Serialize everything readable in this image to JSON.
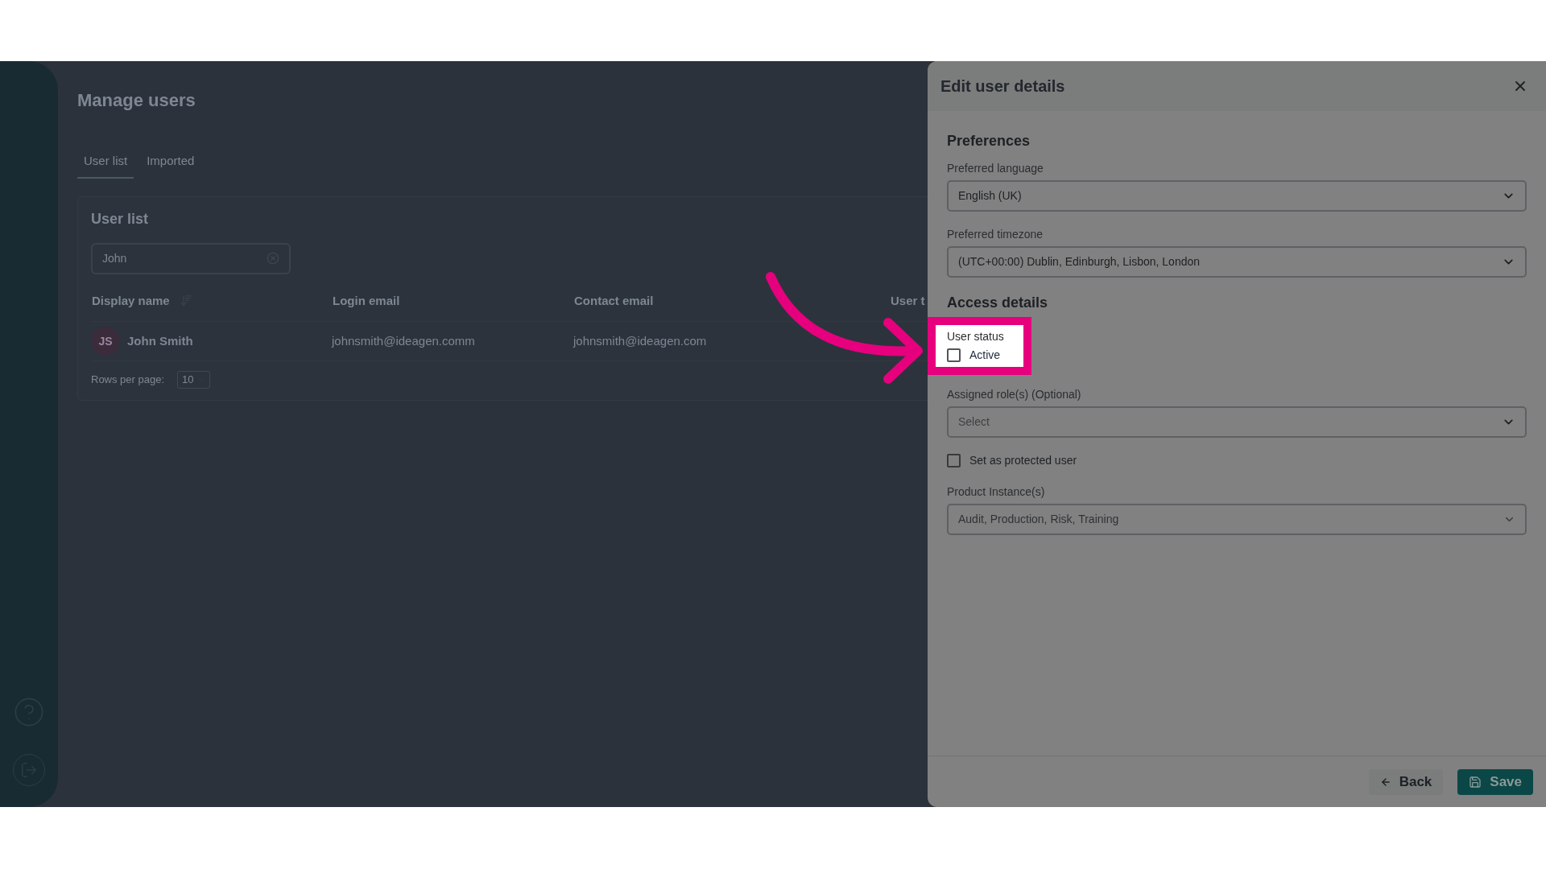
{
  "page": {
    "title": "Manage users",
    "tabs": [
      {
        "label": "User list",
        "selected": true
      },
      {
        "label": "Imported",
        "selected": false
      }
    ],
    "card": {
      "title": "User list",
      "search": {
        "value": "John"
      },
      "columns": [
        "Display name",
        "Login email",
        "Contact email",
        "User t"
      ],
      "rows": [
        {
          "initials": "JS",
          "name": "John Smith",
          "login_email": "johnsmith@ideagen.comm",
          "contact_email": "johnsmith@ideagen.com"
        }
      ],
      "rows_per_page": {
        "label": "Rows per page:",
        "value": "10"
      }
    }
  },
  "panel": {
    "title": "Edit user details",
    "items": [
      {
        "kind": "heading",
        "text": "Preferences"
      },
      {
        "kind": "select",
        "label": "Preferred language",
        "value": "English (UK)"
      },
      {
        "kind": "select",
        "label": "Preferred timezone",
        "value": "(UTC+00:00) Dublin, Edinburgh, Lisbon, London"
      },
      {
        "kind": "heading",
        "text": "Access details"
      },
      {
        "kind": "checkbox_group",
        "label": "User status",
        "option": "Active",
        "checked": false,
        "highlighted": true
      },
      {
        "kind": "select",
        "label": "Assigned role(s) (Optional)",
        "placeholder": "Select"
      },
      {
        "kind": "checkbox",
        "option": "Set as protected user",
        "checked": false
      },
      {
        "kind": "select",
        "label": "Product Instance(s)",
        "value": "Audit, Production, Risk, Training",
        "disabled": true
      }
    ],
    "buttons": [
      {
        "label": "Back",
        "kind": "secondary"
      },
      {
        "label": "Save",
        "kind": "primary"
      }
    ]
  }
}
